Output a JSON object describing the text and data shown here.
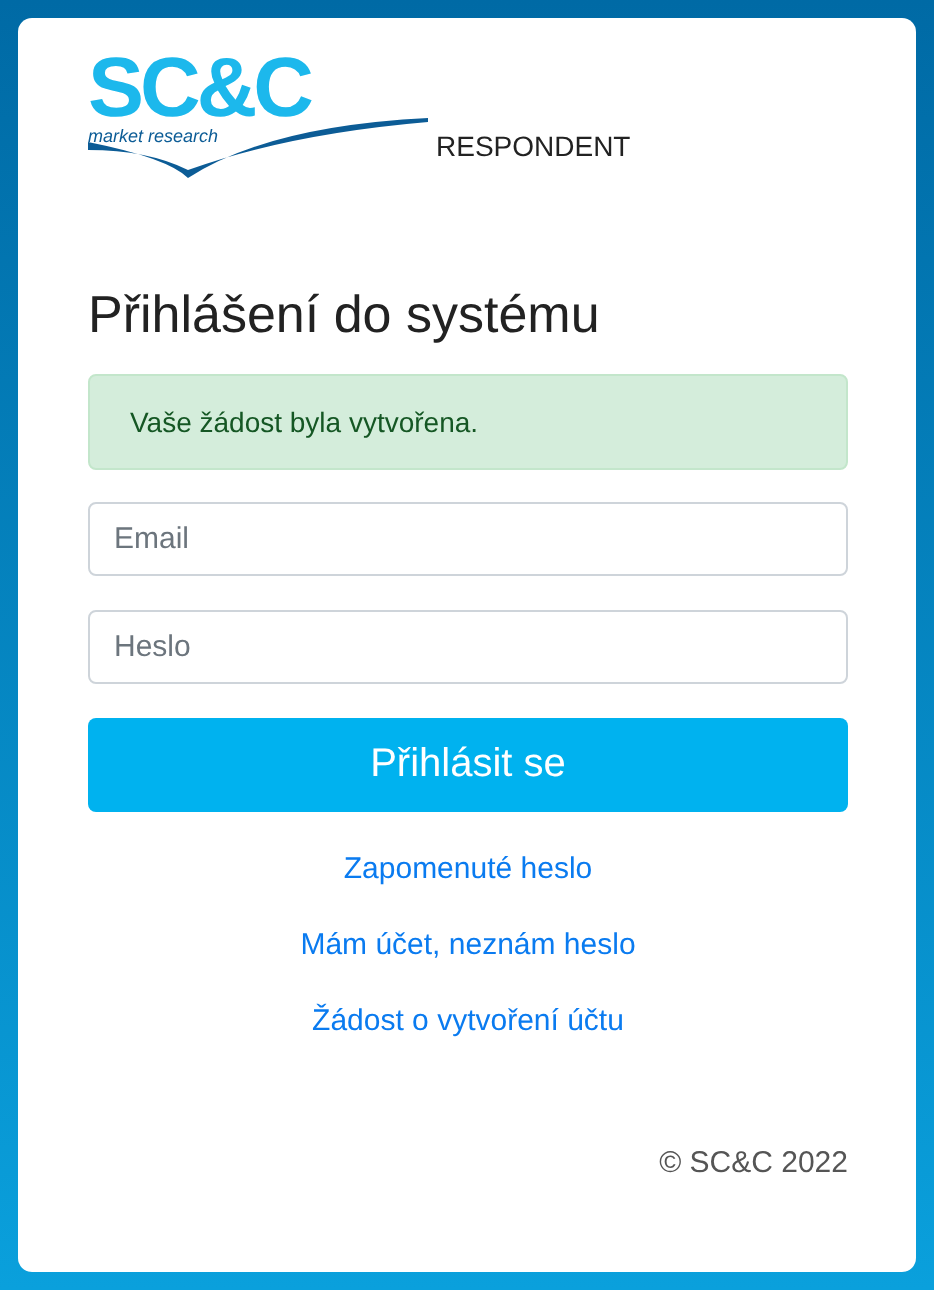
{
  "logo": {
    "name": "SC&C",
    "tagline": "market research"
  },
  "portal": "RESPONDENT",
  "heading": "Přihlášení do systému",
  "alert": {
    "kind": "success",
    "text": "Vaše žádost byla vytvořena."
  },
  "fields": [
    {
      "placeholder": "Email"
    },
    {
      "placeholder": "Heslo"
    }
  ],
  "submit": "Přihlásit se",
  "links": [
    "Zapomenuté heslo",
    "Mám účet, neznám heslo",
    "Žádost o vytvoření účtu"
  ],
  "footer": "© SC&C 2022"
}
